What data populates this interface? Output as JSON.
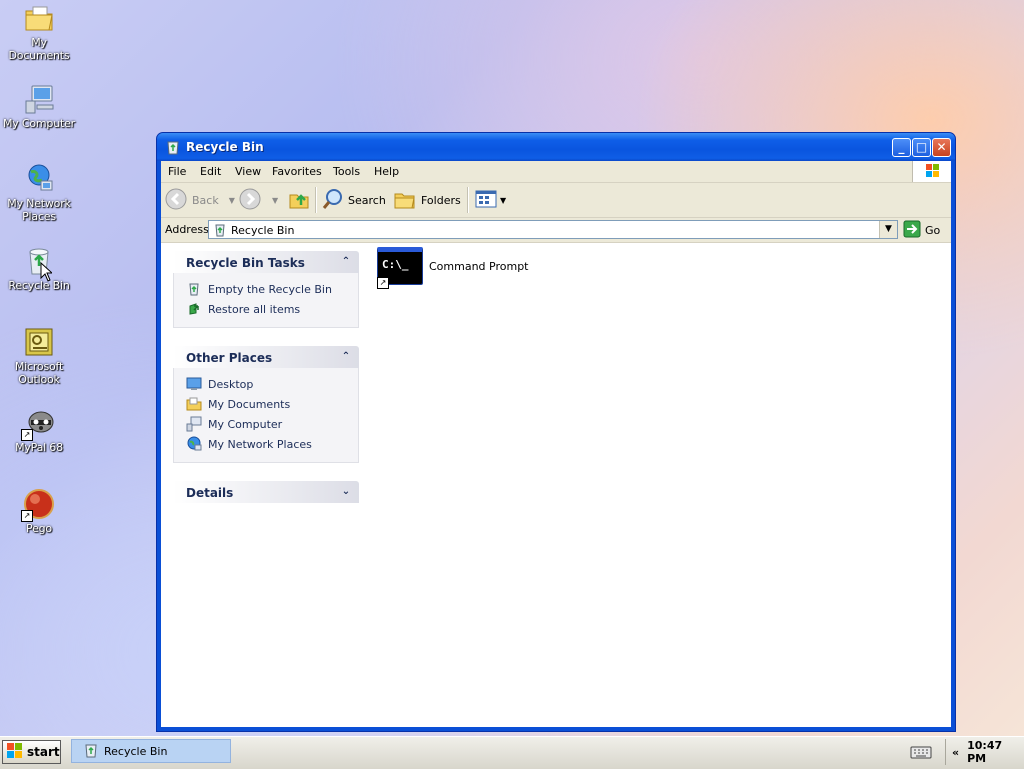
{
  "desktop": {
    "icons": [
      {
        "label": "My Documents"
      },
      {
        "label": "My Computer"
      },
      {
        "label": "My Network Places"
      },
      {
        "label": "Recycle Bin"
      },
      {
        "label": "Microsoft Outlook"
      },
      {
        "label": "MyPal 68"
      },
      {
        "label": "Pego"
      }
    ]
  },
  "window": {
    "title": "Recycle Bin",
    "menu": [
      "File",
      "Edit",
      "View",
      "Favorites",
      "Tools",
      "Help"
    ],
    "toolbar": {
      "back": "Back",
      "search": "Search",
      "folders": "Folders"
    },
    "address": {
      "label": "Address",
      "value": "Recycle Bin",
      "go": "Go"
    },
    "panels": {
      "tasks": {
        "title": "Recycle Bin Tasks",
        "items": [
          "Empty the Recycle Bin",
          "Restore all items"
        ]
      },
      "other_places": {
        "title": "Other Places",
        "items": [
          "Desktop",
          "My Documents",
          "My Computer",
          "My Network Places"
        ]
      },
      "details": {
        "title": "Details"
      }
    },
    "files": [
      {
        "name": "Command Prompt",
        "icon_text": "C:\\_"
      }
    ]
  },
  "taskbar": {
    "start": "start",
    "task": "Recycle Bin",
    "clock": "10:47 PM",
    "tray_toggle": "«"
  },
  "colors": {
    "titlebar": "#0a55df",
    "panel_text": "#1c2d58",
    "taskbar_active": "#b9d3f3"
  }
}
